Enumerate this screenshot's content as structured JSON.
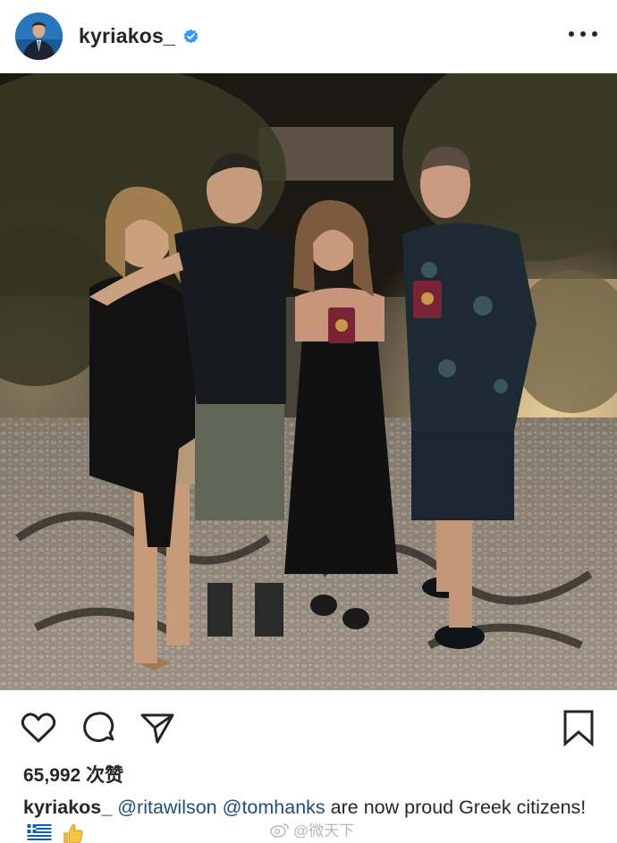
{
  "post": {
    "username": "kyriakos_",
    "verified": true,
    "likes": "65,992 次赞",
    "caption": {
      "author": "kyriakos_",
      "mention_1": "@ritawilson",
      "mention_2": "@tomhanks",
      "text": "are now proud Greek citizens!",
      "emojis": [
        "greek-flag",
        "thumbs-up"
      ]
    }
  },
  "icons": {
    "header": [
      "verified-badge-icon",
      "more-options-icon"
    ],
    "actions": [
      "heart-icon",
      "comment-icon",
      "share-icon",
      "bookmark-icon"
    ]
  },
  "colors": {
    "text": "#262626",
    "mention": "#1b4f82",
    "verified": "#3897f0",
    "flag_blue": "#0d5eaf"
  },
  "watermark": "@微天下"
}
